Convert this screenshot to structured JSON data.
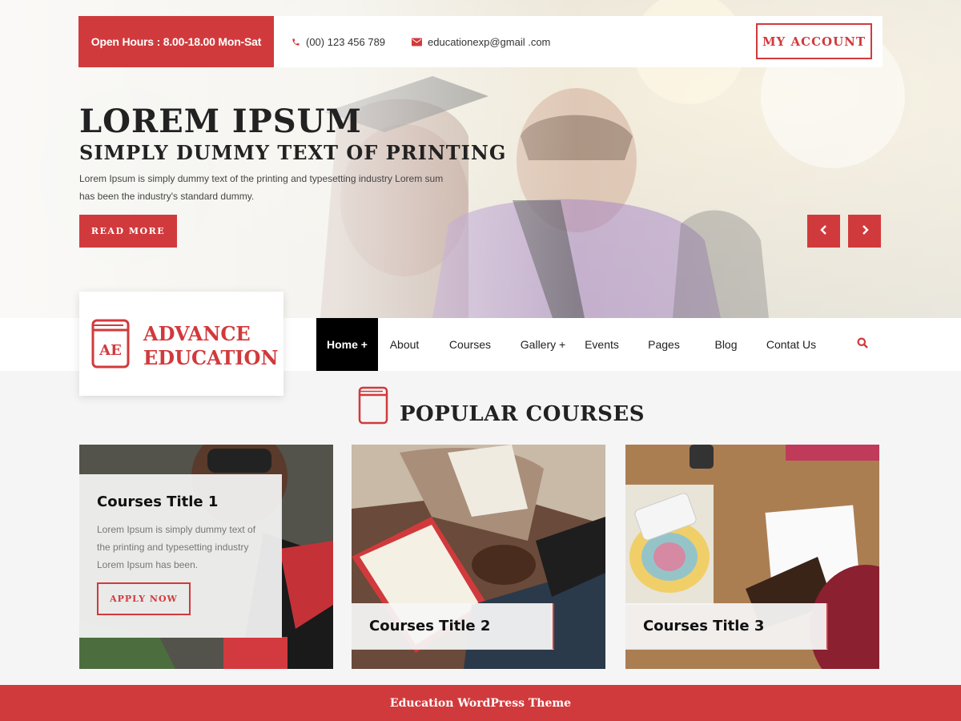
{
  "topbar": {
    "open_hours": "Open Hours : 8.00-18.00 Mon-Sat",
    "phone": "(00) 123 456 789",
    "email": "educationexp@gmail .com",
    "account_label": "MY ACCOUNT"
  },
  "hero": {
    "title": "LOREM IPSUM",
    "subtitle": "SIMPLY DUMMY TEXT OF PRINTING",
    "text": "Lorem Ipsum is simply dummy text of the printing and typesetting industry Lorem sum has been the industry's standard dummy.",
    "read_more": "READ MORE"
  },
  "logo": {
    "icon_letters": "AE",
    "line1": "ADVANCE",
    "line2": "EDUCATION"
  },
  "nav": {
    "items": [
      {
        "label": "Home +",
        "active": true
      },
      {
        "label": "About"
      },
      {
        "label": "Courses"
      },
      {
        "label": "Gallery +"
      },
      {
        "label": "Events"
      },
      {
        "label": "Pages"
      },
      {
        "label": "Blog"
      },
      {
        "label": "Contat Us"
      }
    ]
  },
  "section": {
    "title": "POPULAR COURSES"
  },
  "courses": [
    {
      "title": "Courses Title 1",
      "text": "Lorem Ipsum is simply dummy text of the printing and typesetting industry Lorem Ipsum has been.",
      "button": "APPLY NOW"
    },
    {
      "title": "Courses Title 2"
    },
    {
      "title": "Courses Title 3"
    }
  ],
  "footer": {
    "text": "Education WordPress Theme"
  },
  "colors": {
    "accent": "#d13a3c",
    "nav_active_bg": "#000000",
    "page_bg": "#f5f5f5"
  },
  "icons": [
    "phone-icon",
    "envelope-icon",
    "chevron-left-icon",
    "chevron-right-icon",
    "book-icon",
    "search-icon"
  ]
}
